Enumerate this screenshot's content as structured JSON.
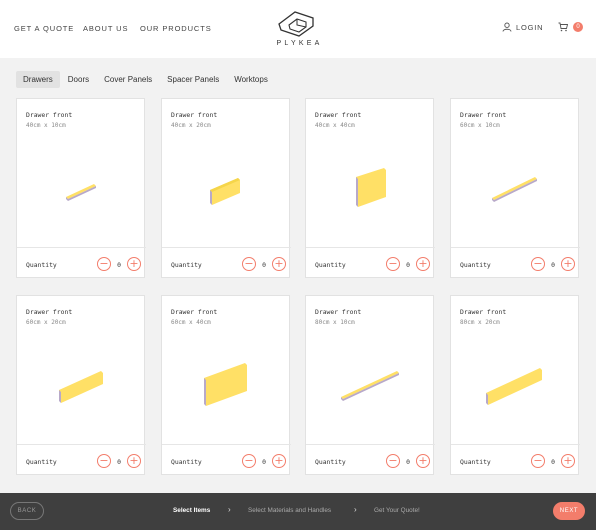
{
  "header": {
    "nav": [
      "GET A QUOTE",
      "ABOUT US",
      "OUR PRODUCTS"
    ],
    "brand": "PLYKEA",
    "login": "LOGIN",
    "cart_count": "0"
  },
  "tabs": [
    "Drawers",
    "Doors",
    "Cover Panels",
    "Spacer Panels",
    "Worktops"
  ],
  "active_tab": "Drawers",
  "products": [
    {
      "title": "Drawer front",
      "size": "40cm x 10cm",
      "quantity_label": "Quantity",
      "quantity": "0"
    },
    {
      "title": "Drawer front",
      "size": "40cm x 20cm",
      "quantity_label": "Quantity",
      "quantity": "0"
    },
    {
      "title": "Drawer front",
      "size": "40cm x 40cm",
      "quantity_label": "Quantity",
      "quantity": "0"
    },
    {
      "title": "Drawer front",
      "size": "60cm x 10cm",
      "quantity_label": "Quantity",
      "quantity": "0"
    },
    {
      "title": "Drawer front",
      "size": "60cm x 20cm",
      "quantity_label": "Quantity",
      "quantity": "0"
    },
    {
      "title": "Drawer front",
      "size": "60cm x 40cm",
      "quantity_label": "Quantity",
      "quantity": "0"
    },
    {
      "title": "Drawer front",
      "size": "80cm x 10cm",
      "quantity_label": "Quantity",
      "quantity": "0"
    },
    {
      "title": "Drawer front",
      "size": "80cm x 20cm",
      "quantity_label": "Quantity",
      "quantity": "0"
    }
  ],
  "footer": {
    "back": "BACK",
    "steps": [
      "Select Items",
      "Select Materials and Handles",
      "Get Your Quote!"
    ],
    "next": "NEXT"
  },
  "colors": {
    "accent": "#f37d6b",
    "panel_face": "#ffe066",
    "panel_edge": "#b8a9c9",
    "footer_bg": "#3f3f3f"
  }
}
